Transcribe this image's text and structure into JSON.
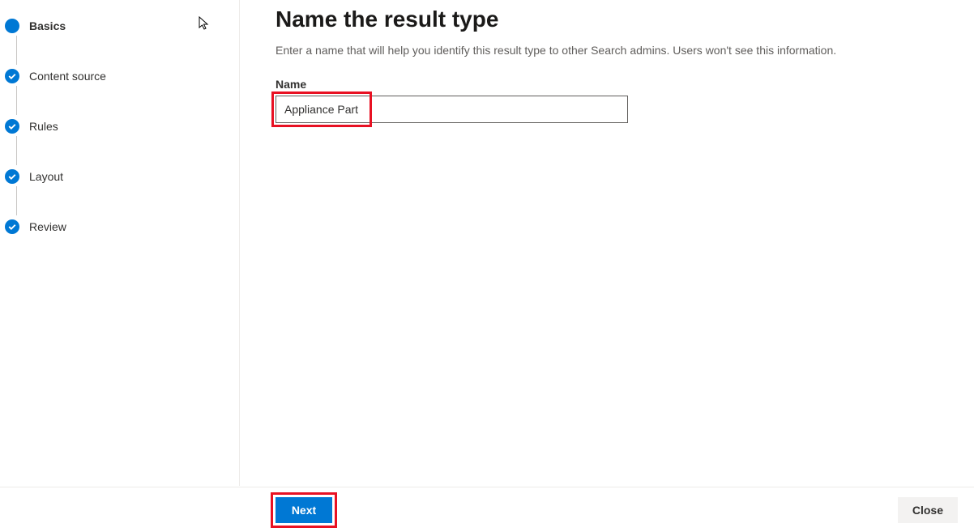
{
  "wizard": {
    "steps": [
      {
        "label": "Basics",
        "state": "current"
      },
      {
        "label": "Content source",
        "state": "completed"
      },
      {
        "label": "Rules",
        "state": "completed"
      },
      {
        "label": "Layout",
        "state": "completed"
      },
      {
        "label": "Review",
        "state": "completed"
      }
    ]
  },
  "page": {
    "title": "Name the result type",
    "subtitle": "Enter a name that will help you identify this result type to other Search admins. Users won't see this information."
  },
  "form": {
    "name_label": "Name",
    "name_value": "Appliance Part"
  },
  "footer": {
    "next_label": "Next",
    "close_label": "Close"
  },
  "colors": {
    "primary": "#0078d4",
    "highlight": "#e81123"
  }
}
